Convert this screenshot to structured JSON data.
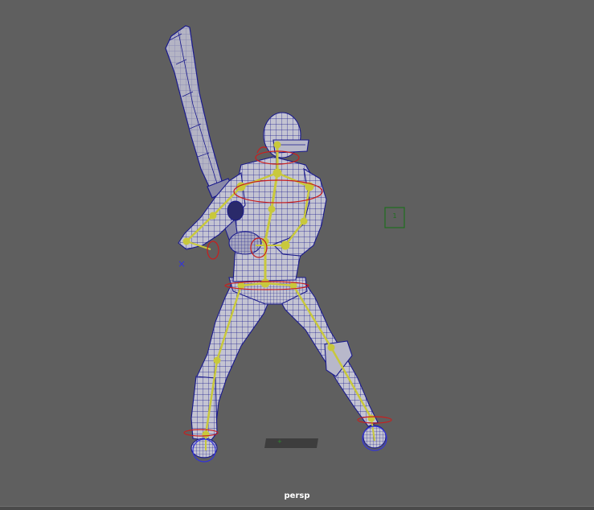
{
  "viewport": {
    "camera": "persp",
    "background": "#5f5f5f"
  },
  "scene": {
    "locator_label": "1",
    "colors": {
      "mesh_fill": "#c4c4d2",
      "wireframe": "#1a1a8c",
      "skeleton": "#c8c83c",
      "ik_control": "#c81e1e",
      "selection": "#3232dc",
      "locator": "#1e6e1e"
    }
  }
}
